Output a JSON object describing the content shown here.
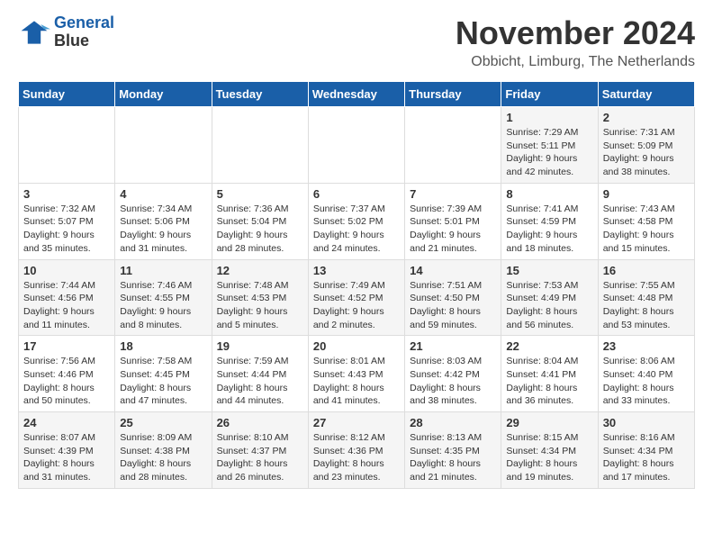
{
  "header": {
    "logo_line1": "General",
    "logo_line2": "Blue",
    "month_title": "November 2024",
    "location": "Obbicht, Limburg, The Netherlands"
  },
  "weekdays": [
    "Sunday",
    "Monday",
    "Tuesday",
    "Wednesday",
    "Thursday",
    "Friday",
    "Saturday"
  ],
  "weeks": [
    [
      {
        "day": "",
        "info": ""
      },
      {
        "day": "",
        "info": ""
      },
      {
        "day": "",
        "info": ""
      },
      {
        "day": "",
        "info": ""
      },
      {
        "day": "",
        "info": ""
      },
      {
        "day": "1",
        "info": "Sunrise: 7:29 AM\nSunset: 5:11 PM\nDaylight: 9 hours and 42 minutes."
      },
      {
        "day": "2",
        "info": "Sunrise: 7:31 AM\nSunset: 5:09 PM\nDaylight: 9 hours and 38 minutes."
      }
    ],
    [
      {
        "day": "3",
        "info": "Sunrise: 7:32 AM\nSunset: 5:07 PM\nDaylight: 9 hours and 35 minutes."
      },
      {
        "day": "4",
        "info": "Sunrise: 7:34 AM\nSunset: 5:06 PM\nDaylight: 9 hours and 31 minutes."
      },
      {
        "day": "5",
        "info": "Sunrise: 7:36 AM\nSunset: 5:04 PM\nDaylight: 9 hours and 28 minutes."
      },
      {
        "day": "6",
        "info": "Sunrise: 7:37 AM\nSunset: 5:02 PM\nDaylight: 9 hours and 24 minutes."
      },
      {
        "day": "7",
        "info": "Sunrise: 7:39 AM\nSunset: 5:01 PM\nDaylight: 9 hours and 21 minutes."
      },
      {
        "day": "8",
        "info": "Sunrise: 7:41 AM\nSunset: 4:59 PM\nDaylight: 9 hours and 18 minutes."
      },
      {
        "day": "9",
        "info": "Sunrise: 7:43 AM\nSunset: 4:58 PM\nDaylight: 9 hours and 15 minutes."
      }
    ],
    [
      {
        "day": "10",
        "info": "Sunrise: 7:44 AM\nSunset: 4:56 PM\nDaylight: 9 hours and 11 minutes."
      },
      {
        "day": "11",
        "info": "Sunrise: 7:46 AM\nSunset: 4:55 PM\nDaylight: 9 hours and 8 minutes."
      },
      {
        "day": "12",
        "info": "Sunrise: 7:48 AM\nSunset: 4:53 PM\nDaylight: 9 hours and 5 minutes."
      },
      {
        "day": "13",
        "info": "Sunrise: 7:49 AM\nSunset: 4:52 PM\nDaylight: 9 hours and 2 minutes."
      },
      {
        "day": "14",
        "info": "Sunrise: 7:51 AM\nSunset: 4:50 PM\nDaylight: 8 hours and 59 minutes."
      },
      {
        "day": "15",
        "info": "Sunrise: 7:53 AM\nSunset: 4:49 PM\nDaylight: 8 hours and 56 minutes."
      },
      {
        "day": "16",
        "info": "Sunrise: 7:55 AM\nSunset: 4:48 PM\nDaylight: 8 hours and 53 minutes."
      }
    ],
    [
      {
        "day": "17",
        "info": "Sunrise: 7:56 AM\nSunset: 4:46 PM\nDaylight: 8 hours and 50 minutes."
      },
      {
        "day": "18",
        "info": "Sunrise: 7:58 AM\nSunset: 4:45 PM\nDaylight: 8 hours and 47 minutes."
      },
      {
        "day": "19",
        "info": "Sunrise: 7:59 AM\nSunset: 4:44 PM\nDaylight: 8 hours and 44 minutes."
      },
      {
        "day": "20",
        "info": "Sunrise: 8:01 AM\nSunset: 4:43 PM\nDaylight: 8 hours and 41 minutes."
      },
      {
        "day": "21",
        "info": "Sunrise: 8:03 AM\nSunset: 4:42 PM\nDaylight: 8 hours and 38 minutes."
      },
      {
        "day": "22",
        "info": "Sunrise: 8:04 AM\nSunset: 4:41 PM\nDaylight: 8 hours and 36 minutes."
      },
      {
        "day": "23",
        "info": "Sunrise: 8:06 AM\nSunset: 4:40 PM\nDaylight: 8 hours and 33 minutes."
      }
    ],
    [
      {
        "day": "24",
        "info": "Sunrise: 8:07 AM\nSunset: 4:39 PM\nDaylight: 8 hours and 31 minutes."
      },
      {
        "day": "25",
        "info": "Sunrise: 8:09 AM\nSunset: 4:38 PM\nDaylight: 8 hours and 28 minutes."
      },
      {
        "day": "26",
        "info": "Sunrise: 8:10 AM\nSunset: 4:37 PM\nDaylight: 8 hours and 26 minutes."
      },
      {
        "day": "27",
        "info": "Sunrise: 8:12 AM\nSunset: 4:36 PM\nDaylight: 8 hours and 23 minutes."
      },
      {
        "day": "28",
        "info": "Sunrise: 8:13 AM\nSunset: 4:35 PM\nDaylight: 8 hours and 21 minutes."
      },
      {
        "day": "29",
        "info": "Sunrise: 8:15 AM\nSunset: 4:34 PM\nDaylight: 8 hours and 19 minutes."
      },
      {
        "day": "30",
        "info": "Sunrise: 8:16 AM\nSunset: 4:34 PM\nDaylight: 8 hours and 17 minutes."
      }
    ]
  ]
}
